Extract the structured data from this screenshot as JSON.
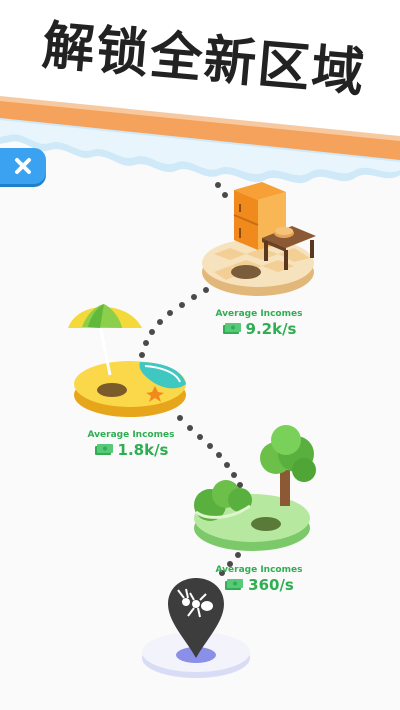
{
  "banner": {
    "title": "解锁全新区域"
  },
  "close_button": {
    "icon": "close-icon",
    "color": "#3aa2f0"
  },
  "areas": [
    {
      "name": "kitchen",
      "income_label": "Average Incomes",
      "income_value": "9.2k/s"
    },
    {
      "name": "beach",
      "income_label": "Average Incomes",
      "income_value": "1.8k/s"
    },
    {
      "name": "forest",
      "income_label": "Average Incomes",
      "income_value": "360/s"
    }
  ],
  "start_marker": {
    "icon": "ant-icon"
  },
  "colors": {
    "income_text": "#2fae52",
    "path_dots": "#4a4a4a",
    "banner_accent": "#f5a25d"
  }
}
